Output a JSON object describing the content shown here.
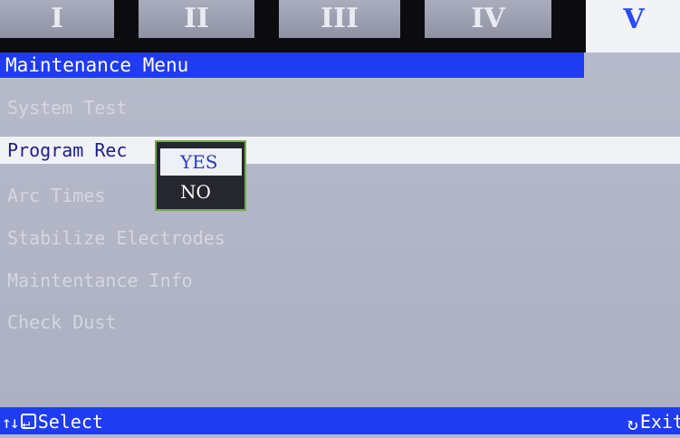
{
  "tabs": [
    {
      "label": "I"
    },
    {
      "label": "II"
    },
    {
      "label": "III"
    },
    {
      "label": "IV"
    },
    {
      "label": "V",
      "active": true
    }
  ],
  "title": "Maintenance Menu",
  "menu": [
    {
      "label": "System Test"
    },
    {
      "label": "Program Rec",
      "selected": true
    },
    {
      "label": "Arc Times"
    },
    {
      "label": "Stabilize Electrodes"
    },
    {
      "label": "Maintentance Info"
    },
    {
      "label": "Check Dust"
    }
  ],
  "popup": {
    "options": [
      {
        "label": "YES",
        "highlighted": true
      },
      {
        "label": "NO"
      }
    ]
  },
  "footer": {
    "nav_icons": [
      "up-arrow-icon",
      "down-arrow-icon",
      "enter-icon"
    ],
    "left_label": "Select",
    "right_icon": "rotate-icon",
    "right_label": "Exit"
  },
  "colors": {
    "accent_blue": "#1f3cf2",
    "active_tab_text": "#2b49ff",
    "popup_border": "#76a84a",
    "screen_bg": "#b3b7c6"
  }
}
